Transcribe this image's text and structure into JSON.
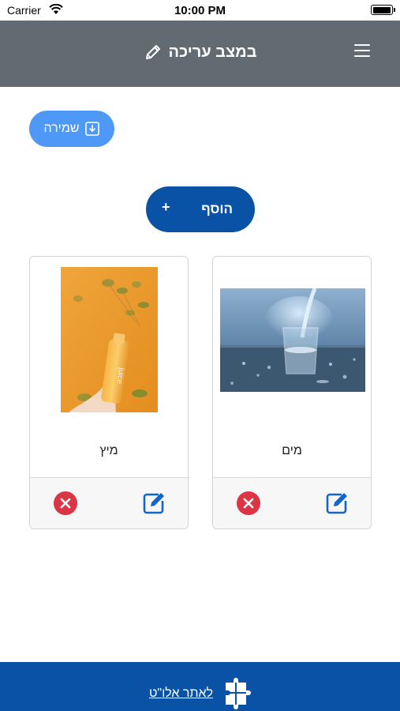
{
  "status_bar": {
    "carrier": "Carrier",
    "time": "10:00 PM"
  },
  "header": {
    "title": "במצב עריכה",
    "edit_icon": "pencil-icon",
    "menu_icon": "hamburger-menu-icon"
  },
  "toolbar": {
    "save_label": "שמירה",
    "save_icon": "save-download-icon",
    "add_label": "הוסף",
    "add_plus": "+"
  },
  "items": [
    {
      "name": "מים",
      "image": "water-glass-photo"
    },
    {
      "name": "מיץ",
      "image": "juice-bottle-photo"
    }
  ],
  "footer": {
    "link_label": "לאתר אלו\"ט",
    "logo": "alut-puzzle-logo"
  },
  "colors": {
    "header": "#636b72",
    "save_button": "#4e98f8",
    "primary": "#0a52a6",
    "delete": "#dc3545",
    "edit": "#1266c9"
  }
}
